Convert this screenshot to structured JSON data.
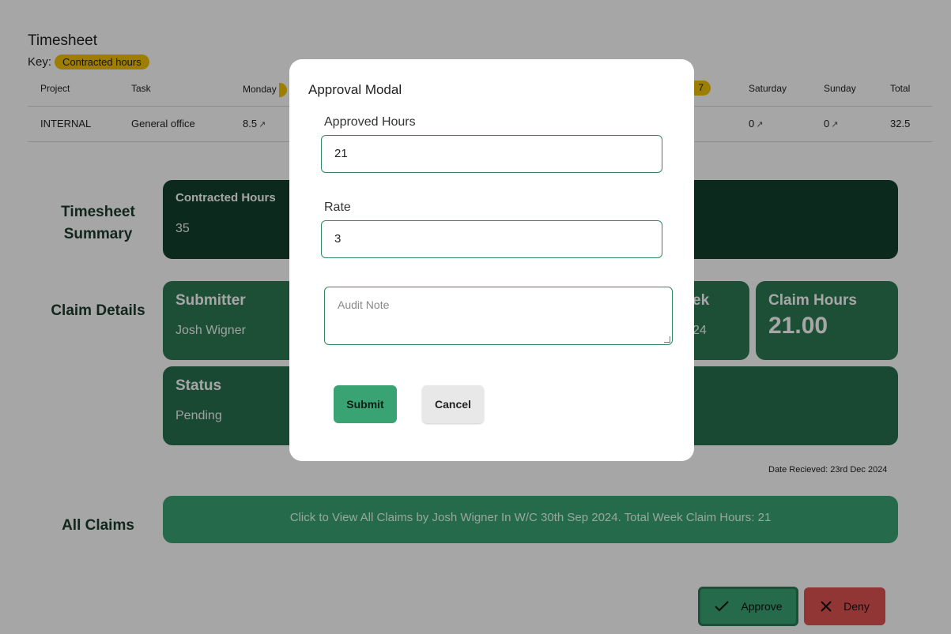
{
  "timesheet": {
    "title": "Timesheet",
    "key_label": "Key:",
    "key_badge": "Contracted hours",
    "columns": {
      "project": "Project",
      "task": "Task",
      "monday": "Monday",
      "friday_badge": "7",
      "saturday": "Saturday",
      "sunday": "Sunday",
      "total": "Total"
    },
    "row": {
      "project": "INTERNAL",
      "task": "General office",
      "monday": "8.5",
      "saturday": "0",
      "sunday": "0",
      "total": "32.5"
    }
  },
  "summary": {
    "label": "Timesheet Summary",
    "contracted_title": "Contracted Hours",
    "contracted_value": "35"
  },
  "claim": {
    "label": "Claim Details",
    "submitter_title": "Submitter",
    "submitter_value": "Josh Wigner",
    "week_title_partial": "ek",
    "week_value_partial": "24",
    "claim_hours_title": "Claim Hours",
    "claim_hours_value": "21.00",
    "status_title": "Status",
    "status_value": "Pending",
    "date_received": "Date Recieved: 23rd Dec 2024"
  },
  "all_claims": {
    "label": "All Claims",
    "bar_text": "Click to View All Claims by Josh Wigner In W/C 30th Sep 2024. Total Week Claim Hours: 21"
  },
  "actions": {
    "approve": "Approve",
    "deny": "Deny"
  },
  "modal": {
    "title": "Approval Modal",
    "approved_hours_label": "Approved Hours",
    "approved_hours_value": "21",
    "rate_label": "Rate",
    "rate_value": "3",
    "audit_note_placeholder": "Audit Note",
    "submit": "Submit",
    "cancel": "Cancel"
  },
  "colors": {
    "brand_green": "#3aa374",
    "dark_green": "#123f2d",
    "key_yellow": "#f2c200",
    "deny_red": "#e05252"
  }
}
